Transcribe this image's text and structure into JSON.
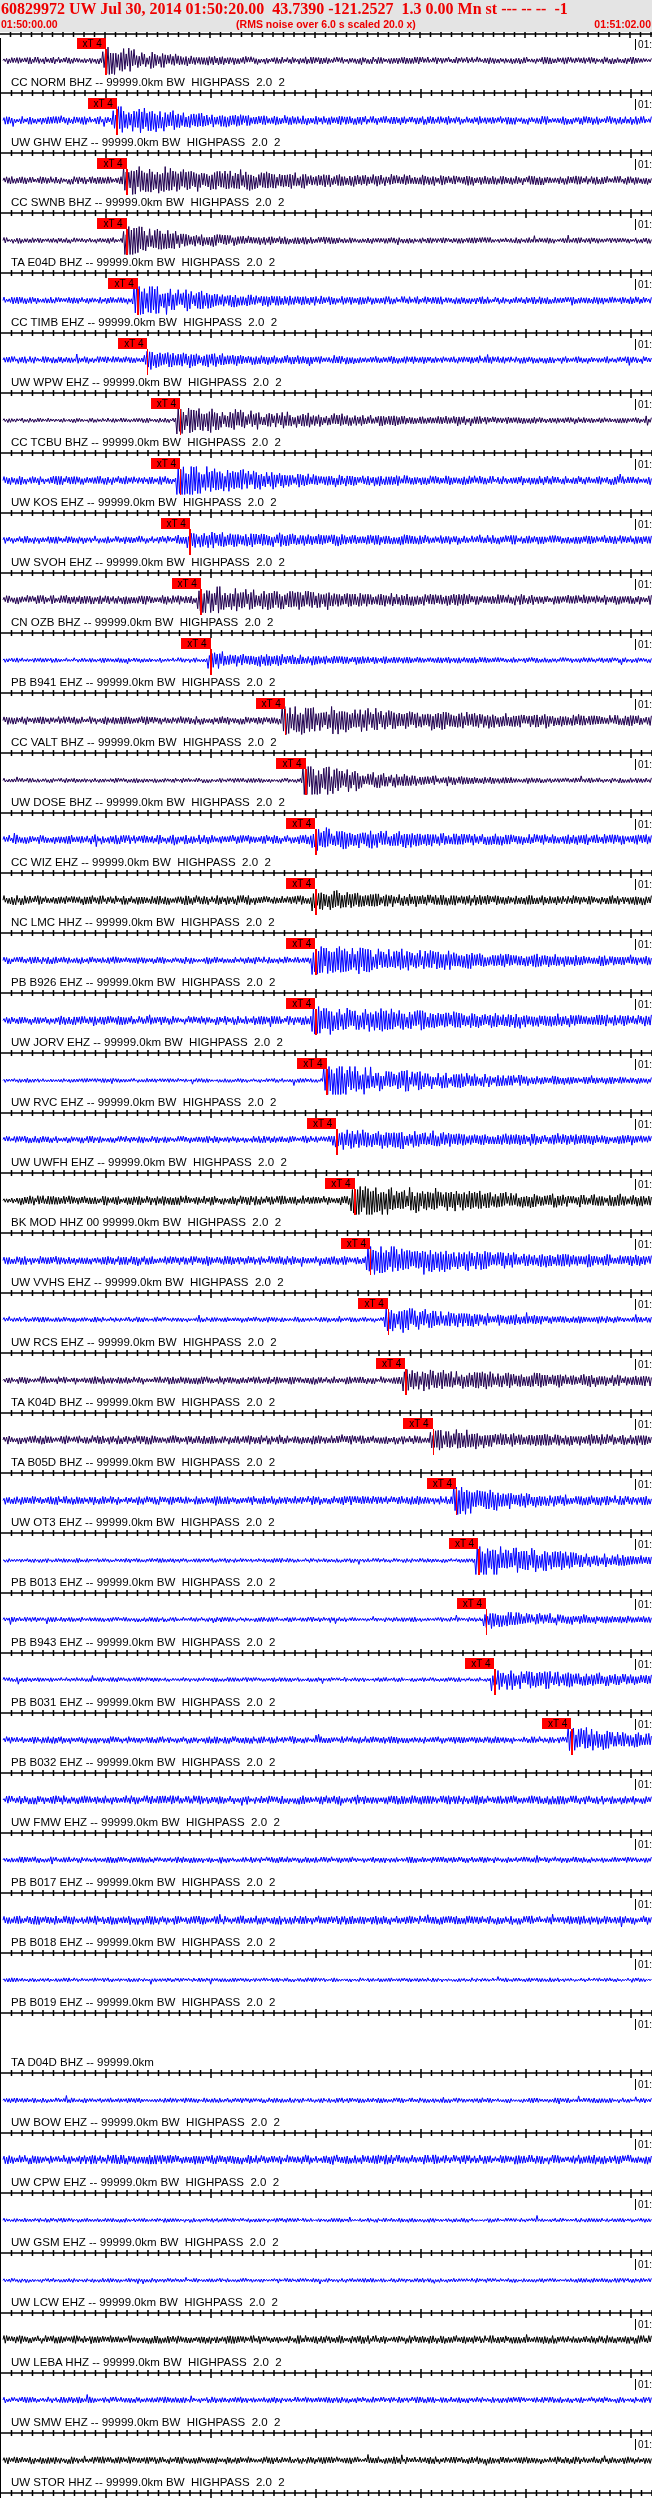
{
  "header": {
    "title": "60829972 UW Jul 30, 2014 01:50:20.00  43.7390 -121.2527  1.3 0.00 Mn st --- -- --  -1",
    "start_time": "01:50:00.00",
    "note": "(RMS noise over 6.0 s scaled 20.0 x)",
    "end_time": "01:51:02.00"
  },
  "traces": [
    {
      "label": "CC NORM BHZ -- 99999.0km BW  HIGHPASS  2.0  2",
      "color": "#200050",
      "corner_time": "01:",
      "pick": {
        "label": "xT 4",
        "level": 0.161
      }
    },
    {
      "label": "UW GHW EHZ -- 99999.0km BW  HIGHPASS  2.0  2",
      "color": "#0000ff",
      "corner_time": "01:",
      "pick": {
        "label": "xT 4",
        "level": 0.178
      }
    },
    {
      "label": "CC SWNB BHZ -- 99999.0km BW  HIGHPASS  2.0  2",
      "color": "#200050",
      "corner_time": "01:",
      "pick": {
        "label": "xT 4",
        "level": 0.193
      }
    },
    {
      "label": "TA E04D BHZ -- 99999.0km BW  HIGHPASS  2.0  2",
      "color": "#200050",
      "corner_time": "01:",
      "pick": {
        "label": "xT 4",
        "level": 0.193
      }
    },
    {
      "label": "CC TIMB EHZ -- 99999.0km BW  HIGHPASS  2.0  2",
      "color": "#0000ff",
      "corner_time": "01:",
      "pick": {
        "label": "xT 4",
        "level": 0.21
      }
    },
    {
      "label": "UW WPW EHZ -- 99999.0km BW  HIGHPASS  2.0  2",
      "color": "#0000ff",
      "corner_time": "01:",
      "pick": {
        "label": "xT 4",
        "level": 0.225
      }
    },
    {
      "label": "CC TCBU BHZ -- 99999.0km BW  HIGHPASS  2.0  2",
      "color": "#200050",
      "corner_time": "01:",
      "pick": {
        "label": "xT 4",
        "level": 0.275
      }
    },
    {
      "label": "UW KOS EHZ -- 99999.0km BW  HIGHPASS  2.0  2",
      "color": "#0000ff",
      "corner_time": "01:",
      "pick": {
        "label": "xT 4",
        "level": 0.275
      }
    },
    {
      "label": "UW SVOH EHZ -- 99999.0km BW  HIGHPASS  2.0  2",
      "color": "#0000ff",
      "corner_time": "01:",
      "pick": {
        "label": "xT 4",
        "level": 0.29
      }
    },
    {
      "label": "CN OZB BHZ -- 99999.0km BW  HIGHPASS  2.0  2",
      "color": "#200050",
      "corner_time": "01:",
      "pick": {
        "label": "xT 4",
        "level": 0.307
      }
    },
    {
      "label": "PB B941 EHZ -- 99999.0km BW  HIGHPASS  2.0  2",
      "color": "#0000ff",
      "corner_time": "01:",
      "pick": {
        "label": "xT 4",
        "level": 0.322
      }
    },
    {
      "label": "CC VALT BHZ -- 99999.0km BW  HIGHPASS  2.0  2",
      "color": "#200050",
      "corner_time": "01:",
      "pick": {
        "label": "xT 4",
        "level": 0.436
      }
    },
    {
      "label": "UW DOSE BHZ -- 99999.0km BW  HIGHPASS  2.0  2",
      "color": "#200050",
      "corner_time": "01:",
      "pick": {
        "label": "xT 4",
        "level": 0.468
      }
    },
    {
      "label": "CC WIZ EHZ -- 99999.0km BW  HIGHPASS  2.0  2",
      "color": "#0000ff",
      "corner_time": "01:",
      "pick": {
        "label": "xT 4",
        "level": 0.483
      }
    },
    {
      "label": "NC LMC HHZ -- 99999.0km BW  HIGHPASS  2.0  2",
      "color": "#000000",
      "corner_time": "01:",
      "pick": {
        "label": "xT 4",
        "level": 0.483
      }
    },
    {
      "label": "PB B926 EHZ -- 99999.0km BW  HIGHPASS  2.0  2",
      "color": "#0000ff",
      "corner_time": "01:",
      "pick": {
        "label": "xT 4",
        "level": 0.483
      }
    },
    {
      "label": "UW JORV EHZ -- 99999.0km BW  HIGHPASS  2.0  2",
      "color": "#0000ff",
      "corner_time": "01:",
      "pick": {
        "label": "xT 4",
        "level": 0.483
      }
    },
    {
      "label": "UW RVC EHZ -- 99999.0km BW  HIGHPASS  2.0  2",
      "color": "#0000ff",
      "corner_time": "01:",
      "pick": {
        "label": "xT 4",
        "level": 0.5
      }
    },
    {
      "label": "UW UWFH EHZ -- 99999.0km BW  HIGHPASS  2.0  2",
      "color": "#0000ff",
      "corner_time": "01:",
      "pick": {
        "label": "xT 4",
        "level": 0.515
      }
    },
    {
      "label": "BK MOD HHZ 00 99999.0km BW  HIGHPASS  2.0  2",
      "color": "#000000",
      "corner_time": "01:",
      "pick": {
        "label": "xT 4",
        "level": 0.543
      }
    },
    {
      "label": "UW VVHS EHZ -- 99999.0km BW  HIGHPASS  2.0  2",
      "color": "#0000ff",
      "corner_time": "01:",
      "pick": {
        "label": "xT 4",
        "level": 0.567
      }
    },
    {
      "label": "UW RCS EHZ -- 99999.0km BW  HIGHPASS  2.0  2",
      "color": "#0000ff",
      "corner_time": "01:",
      "pick": {
        "label": "xT 4",
        "level": 0.594
      }
    },
    {
      "label": "TA K04D BHZ -- 99999.0km BW  HIGHPASS  2.0  2",
      "color": "#200050",
      "corner_time": "01:",
      "pick": {
        "label": "xT 4",
        "level": 0.621
      }
    },
    {
      "label": "TA B05D BHZ -- 99999.0km BW  HIGHPASS  2.0  2",
      "color": "#200050",
      "corner_time": "01:",
      "pick": {
        "label": "xT 4",
        "level": 0.663
      }
    },
    {
      "label": "UW OT3 EHZ -- 99999.0km BW  HIGHPASS  2.0  2",
      "color": "#0000ff",
      "corner_time": "01:",
      "pick": {
        "label": "xT 4",
        "level": 0.699
      }
    },
    {
      "label": "PB B013 EHZ -- 99999.0km BW  HIGHPASS  2.0  2",
      "color": "#0000ff",
      "corner_time": "01:",
      "pick": {
        "label": "xT 4",
        "level": 0.733
      }
    },
    {
      "label": "PB B943 EHZ -- 99999.0km BW  HIGHPASS  2.0  2",
      "color": "#0000ff",
      "corner_time": "01:",
      "pick": {
        "label": "xT 4",
        "level": 0.745
      }
    },
    {
      "label": "PB B031 EHZ -- 99999.0km BW  HIGHPASS  2.0  2",
      "color": "#0000ff",
      "corner_time": "01:",
      "pick": {
        "label": "xT 4",
        "level": 0.758
      }
    },
    {
      "label": "PB B032 EHZ -- 99999.0km BW  HIGHPASS  2.0  2",
      "color": "#0000ff",
      "corner_time": "01:",
      "pick": {
        "label": "xT 4",
        "level": 0.876
      }
    },
    {
      "label": "UW FMW EHZ -- 99999.0km BW  HIGHPASS  2.0  2",
      "color": "#0000ff",
      "corner_time": "01:"
    },
    {
      "label": "PB B017 EHZ -- 99999.0km BW  HIGHPASS  2.0  2",
      "color": "#0000ff",
      "corner_time": "01:"
    },
    {
      "label": "PB B018 EHZ -- 99999.0km BW  HIGHPASS  2.0  2",
      "color": "#0000ff",
      "corner_time": "01:"
    },
    {
      "label": "PB B019 EHZ -- 99999.0km BW  HIGHPASS  2.0  2",
      "color": "#0000ff",
      "corner_time": "01:"
    },
    {
      "label": "TA D04D BHZ -- 99999.0km",
      "corner_time": "01:"
    },
    {
      "label": "UW BOW EHZ -- 99999.0km BW  HIGHPASS  2.0  2",
      "color": "#0000ff",
      "corner_time": "01:"
    },
    {
      "label": "UW CPW EHZ -- 99999.0km BW  HIGHPASS  2.0  2",
      "color": "#0000ff",
      "corner_time": "01:"
    },
    {
      "label": "UW GSM EHZ -- 99999.0km BW  HIGHPASS  2.0  2",
      "color": "#0000ff",
      "corner_time": "01:"
    },
    {
      "label": "UW LCW EHZ -- 99999.0km BW  HIGHPASS  2.0  2",
      "color": "#0000ff",
      "corner_time": "01:"
    },
    {
      "label": "UW LEBA HHZ -- 99999.0km BW  HIGHPASS  2.0  2",
      "color": "#000000",
      "corner_time": "01:"
    },
    {
      "label": "UW SMW EHZ -- 99999.0km BW  HIGHPASS  2.0  2",
      "color": "#0000ff",
      "corner_time": "01:"
    },
    {
      "label": "UW STOR HHZ -- 99999.0km BW  HIGHPASS  2.0  2",
      "color": "#000000",
      "corner_time": "01:"
    }
  ]
}
